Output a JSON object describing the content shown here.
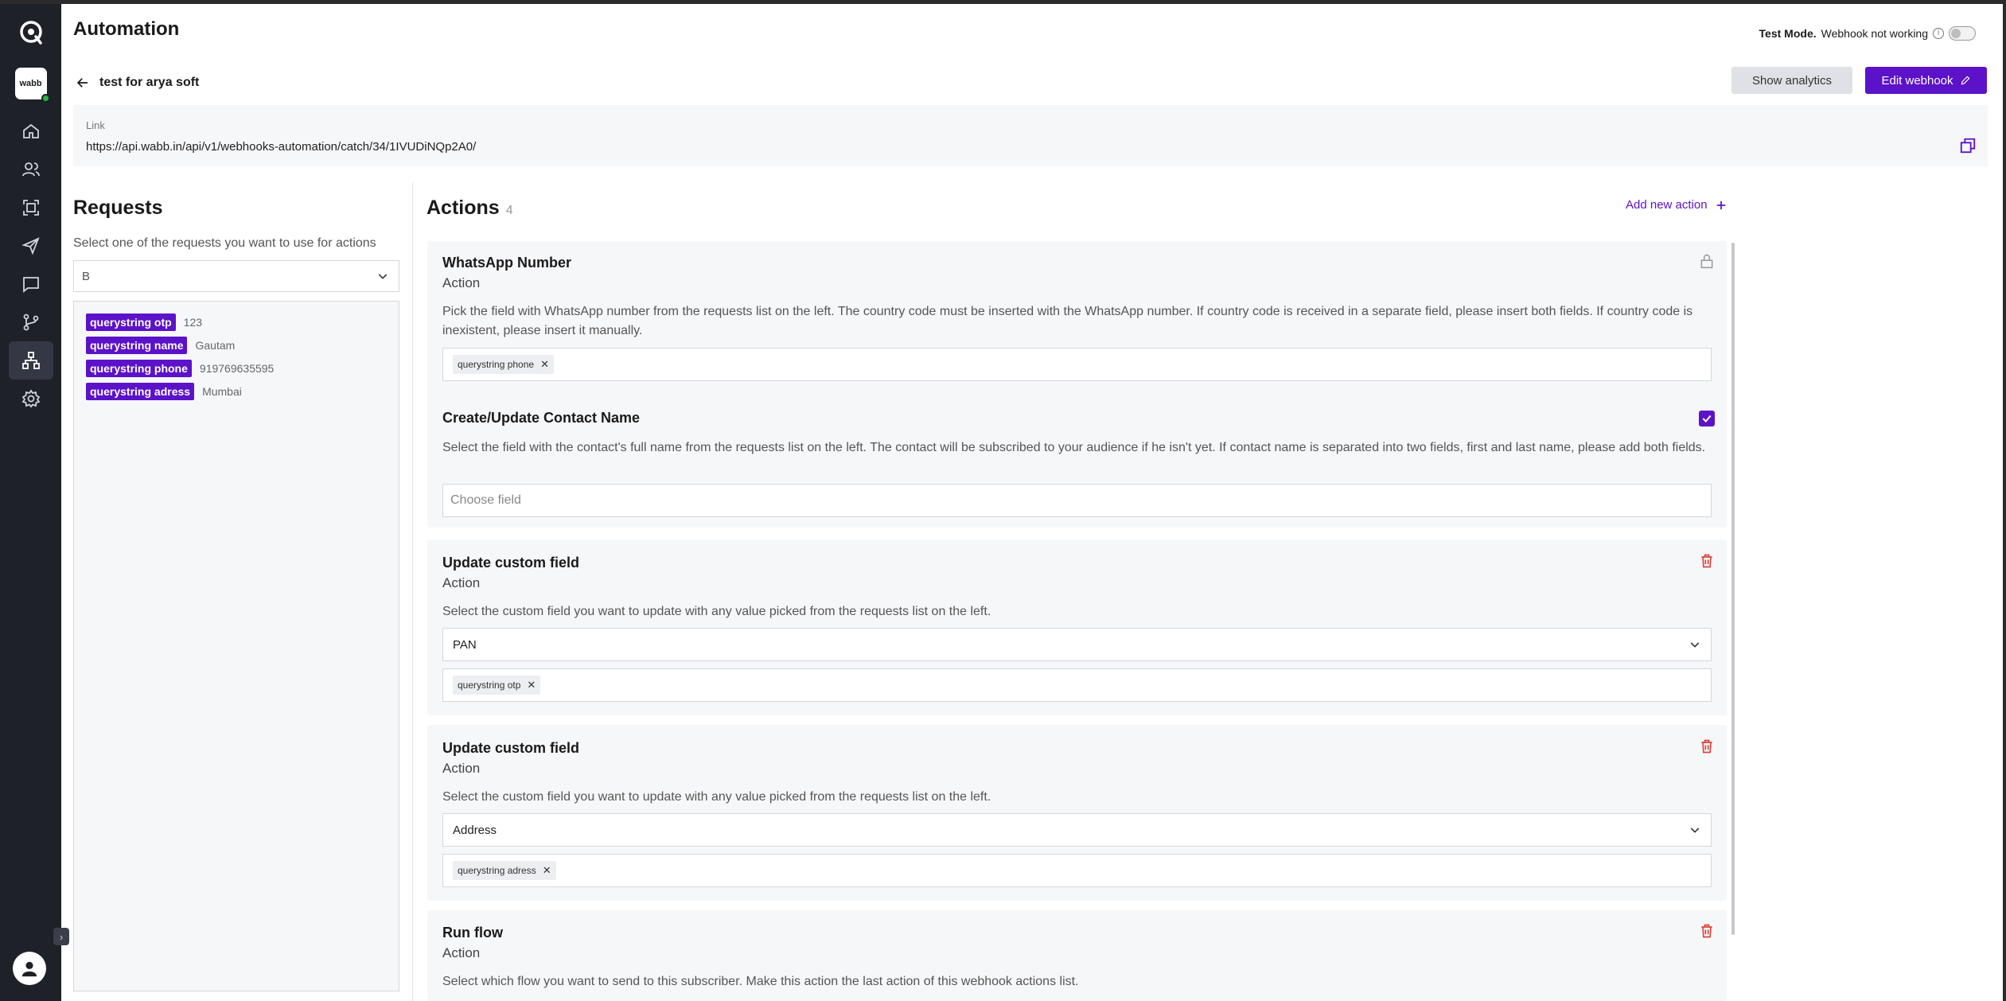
{
  "app": {
    "title": "Automation",
    "brand_label": "wabb"
  },
  "test_mode": {
    "label": "Test Mode.",
    "status": "Webhook not working"
  },
  "webhook": {
    "name": "test for arya soft",
    "show_analytics_label": "Show analytics",
    "edit_label": "Edit webhook",
    "link_label": "Link",
    "link_url": "https://api.wabb.in/api/v1/webhooks-automation/catch/34/1IVUDiNQp2A0/"
  },
  "requests": {
    "title": "Requests",
    "subtitle": "Select one of the requests you want to use for actions",
    "selected": "B",
    "items": [
      {
        "key": "querystring otp",
        "value": "123"
      },
      {
        "key": "querystring name",
        "value": "Gautam"
      },
      {
        "key": "querystring phone",
        "value": "919769635595"
      },
      {
        "key": "querystring adress",
        "value": "Mumbai"
      }
    ]
  },
  "actions": {
    "title": "Actions",
    "count": "4",
    "add_label": "Add new action",
    "cards": [
      {
        "title": "WhatsApp Number",
        "sub": "Action",
        "desc": "Pick the field with WhatsApp number from the requests list on the left. The country code must be inserted with the WhatsApp number. If country code is received in a separate field, please insert both fields. If country code is inexistent, please insert it manually.",
        "chip": "querystring phone"
      },
      {
        "title": "Create/Update Contact Name",
        "desc": "Select the field with the contact's full name from the requests list on the left. The contact will be subscribed to your audience if he isn't yet. If contact name is separated into two fields, first and last name, please add both fields.",
        "placeholder": "Choose field"
      },
      {
        "title": "Update custom field",
        "sub": "Action",
        "desc": "Select the custom field you want to update with any value picked from the requests list on the left.",
        "select": "PAN",
        "chip": "querystring otp"
      },
      {
        "title": "Update custom field",
        "sub": "Action",
        "desc": "Select the custom field you want to update with any value picked from the requests list on the left.",
        "select": "Address",
        "chip": "querystring adress"
      },
      {
        "title": "Run flow",
        "sub": "Action",
        "desc": "Select which flow you want to send to this subscriber. Make this action the last action of this webhook actions list."
      }
    ]
  },
  "colors": {
    "accent": "#5b12c9",
    "sidebar": "#1e2128",
    "danger": "#d9443a"
  }
}
